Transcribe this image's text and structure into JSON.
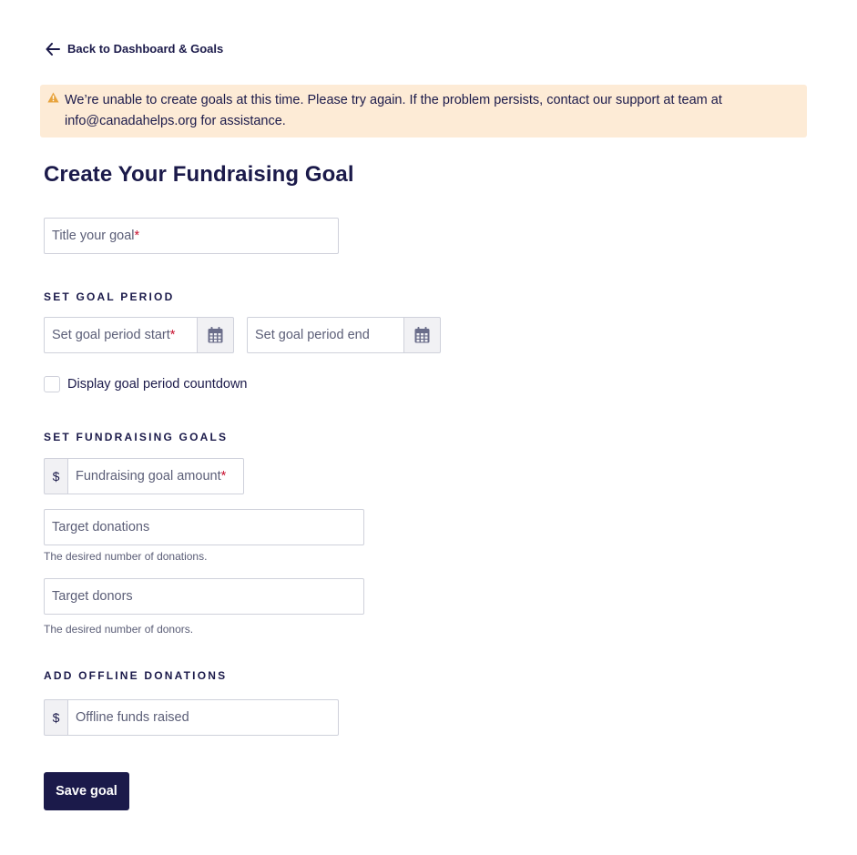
{
  "back_link": {
    "label": "Back to Dashboard & Goals"
  },
  "alert": {
    "message": "We’re unable to create goals at this time.  Please try again. If the problem persists, contact our support at team at info@canadahelps.org for assistance."
  },
  "page_title": "Create Your Fundraising Goal",
  "title_field": {
    "placeholder": "Title your goal",
    "required_mark": "*"
  },
  "goal_period": {
    "heading": "SET GOAL PERIOD",
    "start_placeholder": "Set goal period start",
    "start_required_mark": "*",
    "end_placeholder": "Set goal period end",
    "countdown_label": "Display goal period countdown",
    "countdown_checked": false
  },
  "fundraising_goals": {
    "heading": "SET FUNDRAISING GOALS",
    "currency_symbol": "$",
    "amount_placeholder": "Fundraising goal amount",
    "amount_required_mark": "*",
    "target_donations_placeholder": "Target donations",
    "target_donations_help": "The desired number of donations.",
    "target_donors_placeholder": "Target donors",
    "target_donors_help": "The desired number of donors."
  },
  "offline_donations": {
    "heading": "ADD OFFLINE DONATIONS",
    "currency_symbol": "$",
    "placeholder": "Offline funds raised"
  },
  "save_button": {
    "label": "Save goal"
  },
  "colors": {
    "primary": "#1b1a4a",
    "alert_bg": "#fdebd6",
    "warning": "#e8a33d",
    "required": "#c8102e",
    "icon": "#6a6d8a"
  },
  "icons": {
    "back": "arrow-left-icon",
    "alert": "warning-triangle-icon",
    "calendar": "calendar-icon"
  }
}
